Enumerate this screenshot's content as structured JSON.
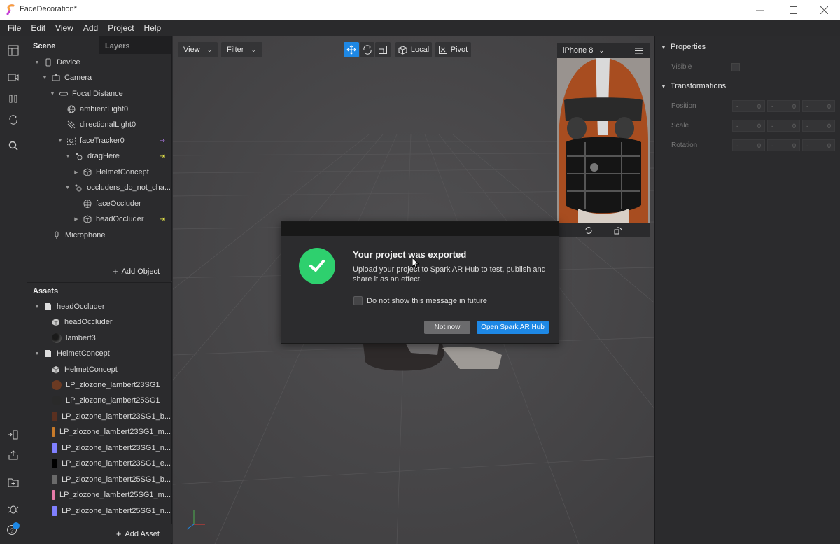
{
  "window": {
    "title": "FaceDecoration*"
  },
  "menu": [
    "File",
    "Edit",
    "View",
    "Add",
    "Project",
    "Help"
  ],
  "scene_panel": {
    "tabs": [
      "Scene",
      "Layers"
    ],
    "tree": [
      {
        "label": "Device",
        "icon": "phone-icon",
        "level": 0,
        "expanded": true
      },
      {
        "label": "Camera",
        "icon": "camera-icon",
        "level": 1,
        "expanded": true
      },
      {
        "label": "Focal Distance",
        "icon": "focal-distance-icon",
        "level": 2,
        "expanded": true
      },
      {
        "label": "ambientLight0",
        "icon": "globe-light-icon",
        "level": 3
      },
      {
        "label": "directionalLight0",
        "icon": "directional-light-icon",
        "level": 3
      },
      {
        "label": "faceTracker0",
        "icon": "face-tracker-icon",
        "level": 3,
        "expanded": true,
        "badge": "↦"
      },
      {
        "label": "dragHere",
        "icon": "null-object-icon",
        "level": 4,
        "expanded": true,
        "badge": "⇥"
      },
      {
        "label": "HelmetConcept",
        "icon": "cube-icon",
        "level": 5,
        "collapsed": true
      },
      {
        "label": "occluders_do_not_cha...",
        "icon": "null-object-icon",
        "level": 4,
        "expanded": true
      },
      {
        "label": "faceOccluder",
        "icon": "face-mesh-icon",
        "level": 5
      },
      {
        "label": "headOccluder",
        "icon": "cube-icon",
        "level": 5,
        "collapsed": true,
        "badge": "⇥"
      },
      {
        "label": "Microphone",
        "icon": "microphone-icon",
        "level": 2
      }
    ],
    "add_object": "Add Object"
  },
  "assets_panel": {
    "title": "Assets",
    "items": [
      {
        "label": "headOccluder",
        "kind": "folder",
        "level": 0
      },
      {
        "label": "headOccluder",
        "kind": "mesh",
        "level": 1
      },
      {
        "label": "lambert3",
        "kind": "material",
        "level": 1,
        "color": "#1a1a1a"
      },
      {
        "label": "HelmetConcept",
        "kind": "folder",
        "level": 0
      },
      {
        "label": "HelmetConcept",
        "kind": "mesh",
        "level": 1
      },
      {
        "label": "LP_zlozone_lambert23SG1",
        "kind": "material",
        "level": 1,
        "color": "#6b3a22"
      },
      {
        "label": "LP_zlozone_lambert25SG1",
        "kind": "material",
        "level": 1,
        "color": "#2a2a2a"
      },
      {
        "label": "LP_zlozone_lambert23SG1_b...",
        "kind": "texture",
        "level": 1,
        "color": "#5a3020"
      },
      {
        "label": "LP_zlozone_lambert23SG1_m...",
        "kind": "texture",
        "level": 1,
        "color": "#c77a2a"
      },
      {
        "label": "LP_zlozone_lambert23SG1_n...",
        "kind": "texture",
        "level": 1,
        "color": "#8080ff"
      },
      {
        "label": "LP_zlozone_lambert23SG1_e...",
        "kind": "texture",
        "level": 1,
        "color": "#000000"
      },
      {
        "label": "LP_zlozone_lambert25SG1_b...",
        "kind": "texture",
        "level": 1,
        "color": "#6a6a6a"
      },
      {
        "label": "LP_zlozone_lambert25SG1_m...",
        "kind": "texture",
        "level": 1,
        "color": "#e67aa8"
      },
      {
        "label": "LP_zlozone_lambert25SG1_n...",
        "kind": "texture",
        "level": 1,
        "color": "#8080ff"
      }
    ],
    "add_asset": "Add Asset"
  },
  "viewport": {
    "view_menu": "View",
    "filter_menu": "Filter",
    "local_label": "Local",
    "pivot_label": "Pivot"
  },
  "preview": {
    "device": "iPhone 8"
  },
  "dialog": {
    "title": "Your project was exported",
    "body": "Upload your project to Spark AR Hub to test, publish and share it as an effect.",
    "checkbox_label": "Do not show this message in future",
    "not_now": "Not now",
    "open_hub": "Open Spark AR Hub"
  },
  "properties": {
    "section1": "Properties",
    "visible_label": "Visible",
    "section2": "Transformations",
    "rows": [
      {
        "label": "Position",
        "values": [
          "0",
          "0",
          "0"
        ]
      },
      {
        "label": "Scale",
        "values": [
          "0",
          "0",
          "0"
        ]
      },
      {
        "label": "Rotation",
        "values": [
          "0",
          "0",
          "0"
        ]
      }
    ]
  },
  "colors": {
    "accent": "#1e88e5",
    "success": "#2ed06e",
    "badge_purple": "#b57cf0",
    "badge_yellow": "#e6e64a"
  }
}
